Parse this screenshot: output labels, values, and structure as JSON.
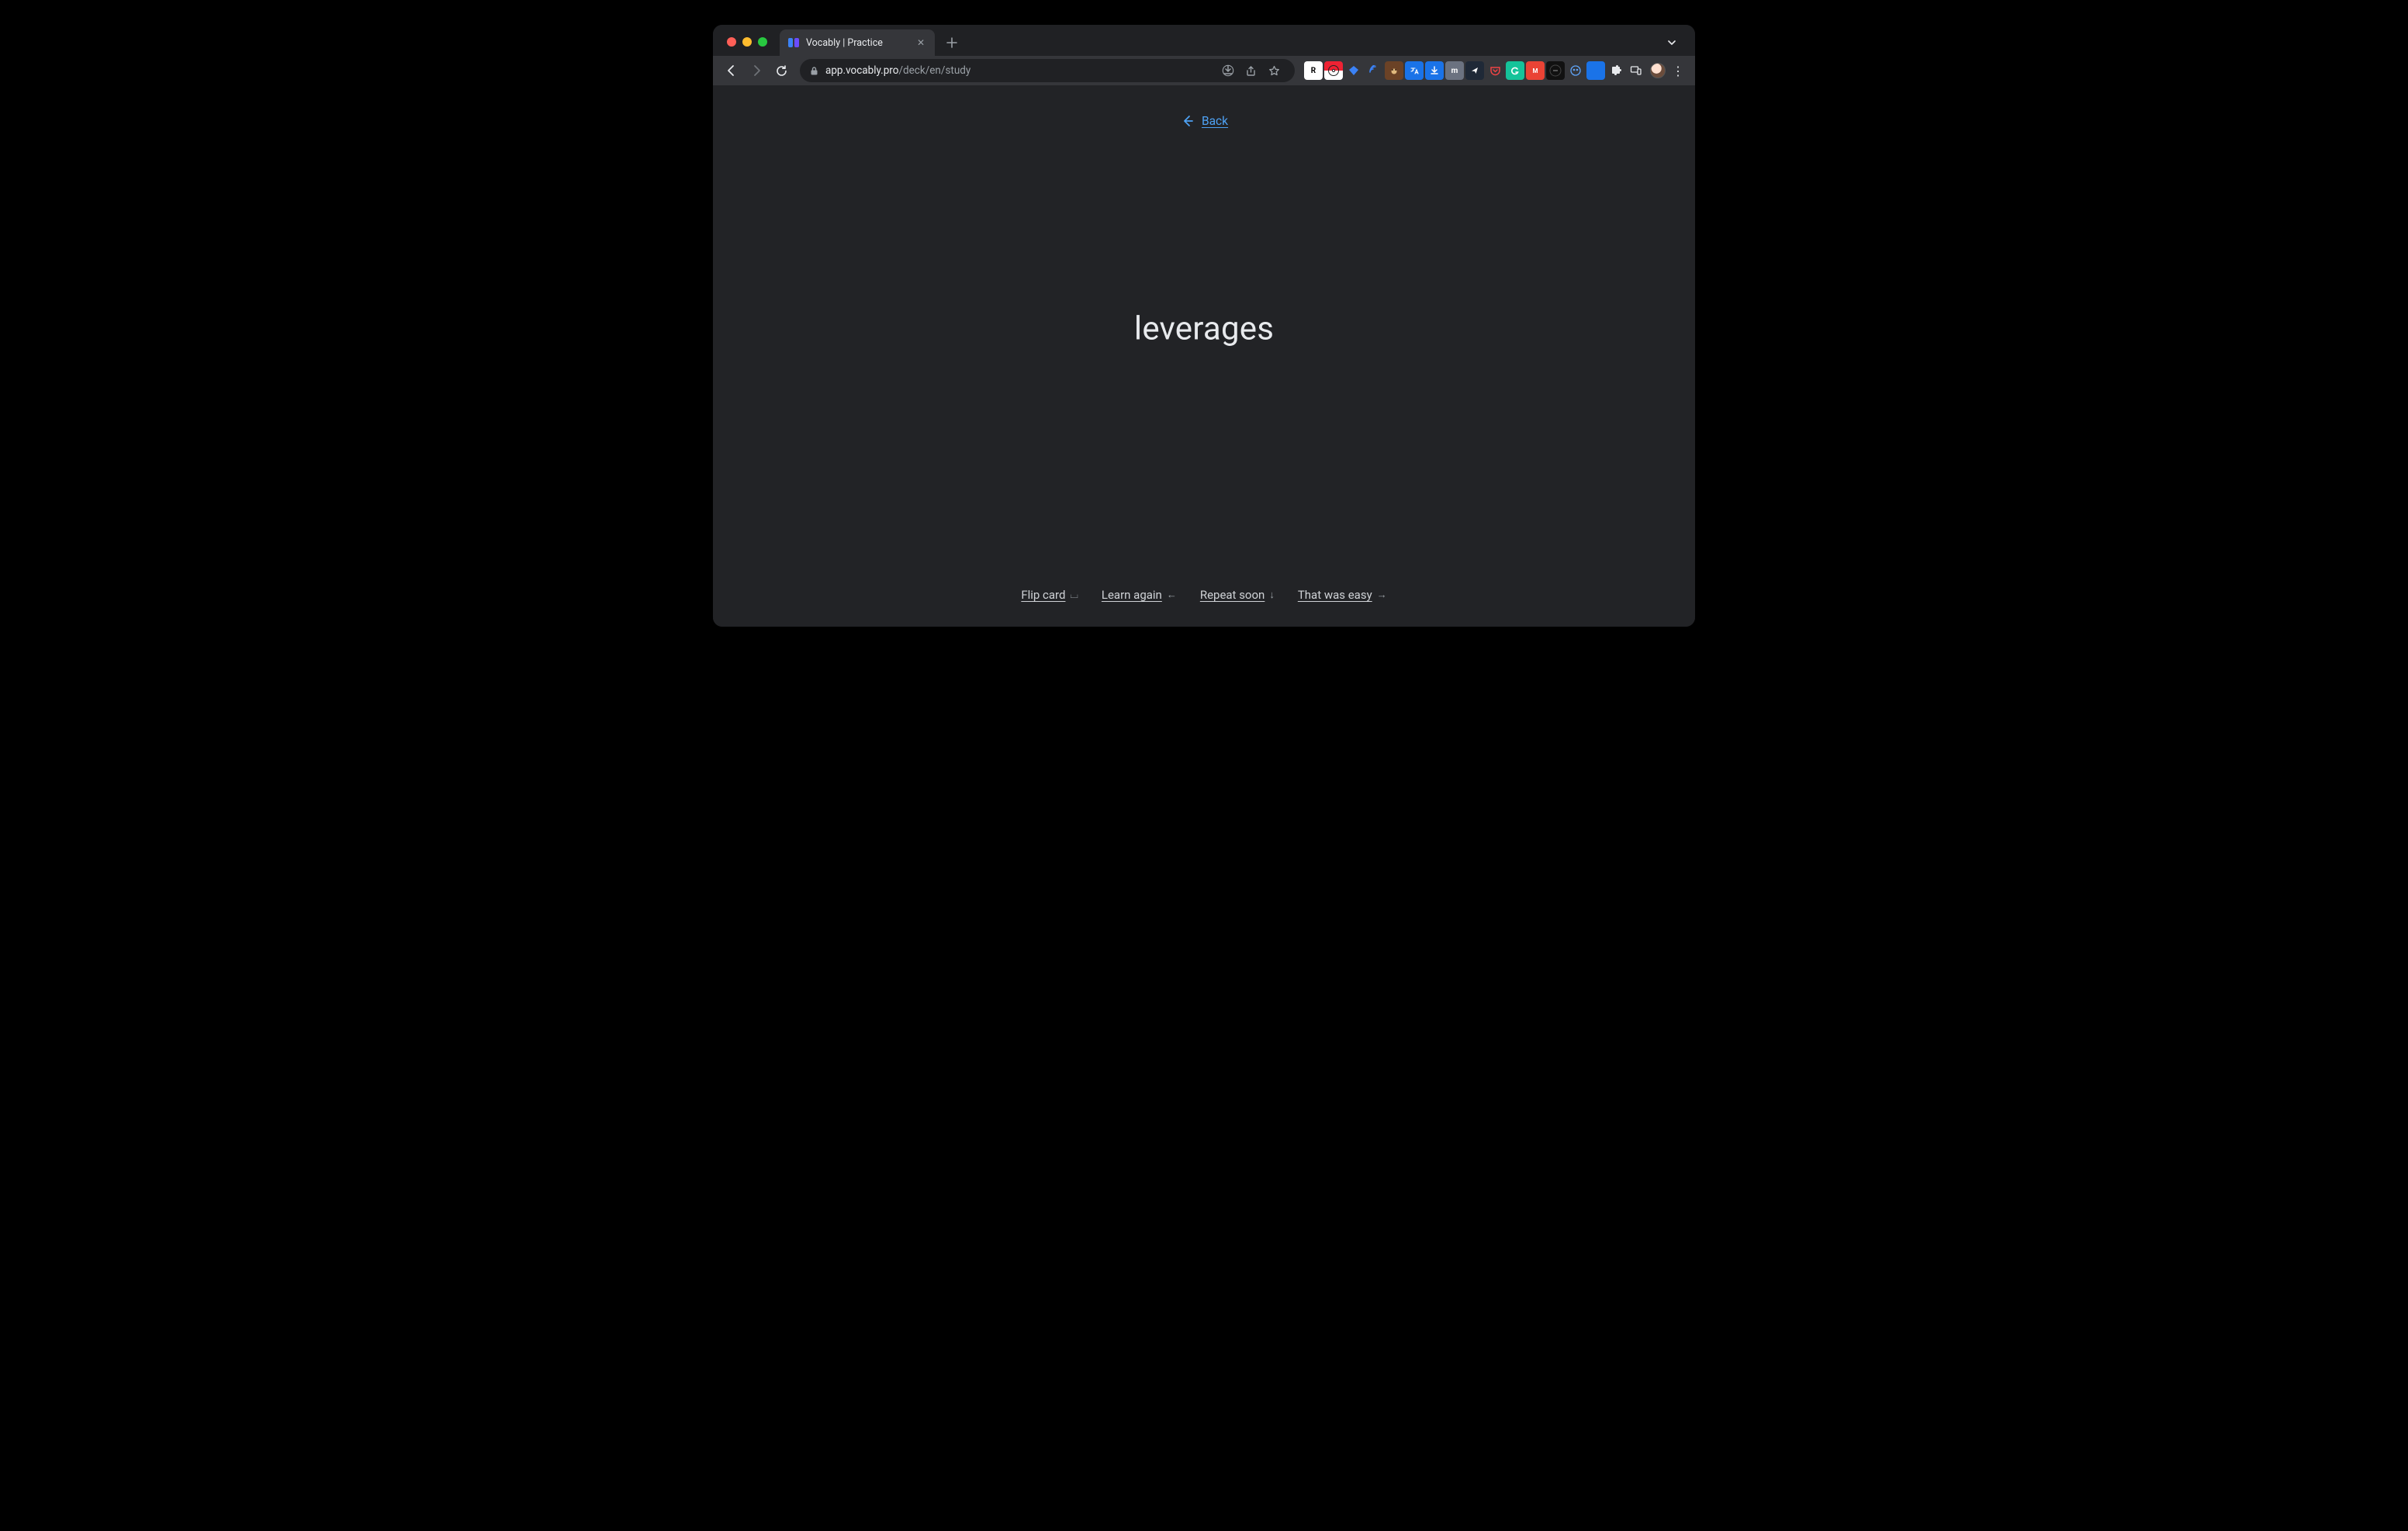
{
  "browser": {
    "tab_title": "Vocably | Practice",
    "url_host": "app.vocably.pro",
    "url_path": "/deck/en/study",
    "extensions": [
      {
        "name": "R",
        "bg": "#ffffff",
        "fg": "#000000"
      },
      {
        "name": "pokeball",
        "bg": "linear-gradient(180deg,#e23 50%,#fff 50%)",
        "fg": "#000"
      },
      {
        "name": "diamond",
        "bg": "transparent",
        "fg": "#3b82f6"
      },
      {
        "name": "wifi",
        "bg": "transparent",
        "fg": "#3b82f6"
      },
      {
        "name": "monkey",
        "bg": "#6b4226",
        "fg": "#fbbf24"
      },
      {
        "name": "gtranslate",
        "bg": "#1a73e8",
        "fg": "#fff"
      },
      {
        "name": "download",
        "bg": "#1a73e8",
        "fg": "#fff"
      },
      {
        "name": "m",
        "bg": "#6b7280",
        "fg": "#fff"
      },
      {
        "name": "send",
        "bg": "#1f2937",
        "fg": "#fff"
      },
      {
        "name": "pocket",
        "bg": "transparent",
        "fg": "#ef4444"
      },
      {
        "name": "grammarly",
        "bg": "#15c39a",
        "fg": "#fff"
      },
      {
        "name": "meet",
        "bg": "#ea4335",
        "fg": "#fff"
      },
      {
        "name": "darkcircle",
        "bg": "#111",
        "fg": "#555"
      },
      {
        "name": "owl",
        "bg": "transparent",
        "fg": "#60a5fa"
      },
      {
        "name": "flag",
        "bg": "#1a73e8",
        "fg": "#fff"
      },
      {
        "name": "puzzle",
        "bg": "transparent",
        "fg": "#e8eaed"
      },
      {
        "name": "devices",
        "bg": "transparent",
        "fg": "#e8eaed"
      }
    ]
  },
  "page": {
    "back_label": "Back",
    "word": "leverages",
    "actions": {
      "flip": "Flip card",
      "learn": "Learn again",
      "repeat": "Repeat soon",
      "easy": "That was easy"
    },
    "hints": {
      "flip": "⌴",
      "learn": "←",
      "repeat": "↓",
      "easy": "→"
    }
  }
}
